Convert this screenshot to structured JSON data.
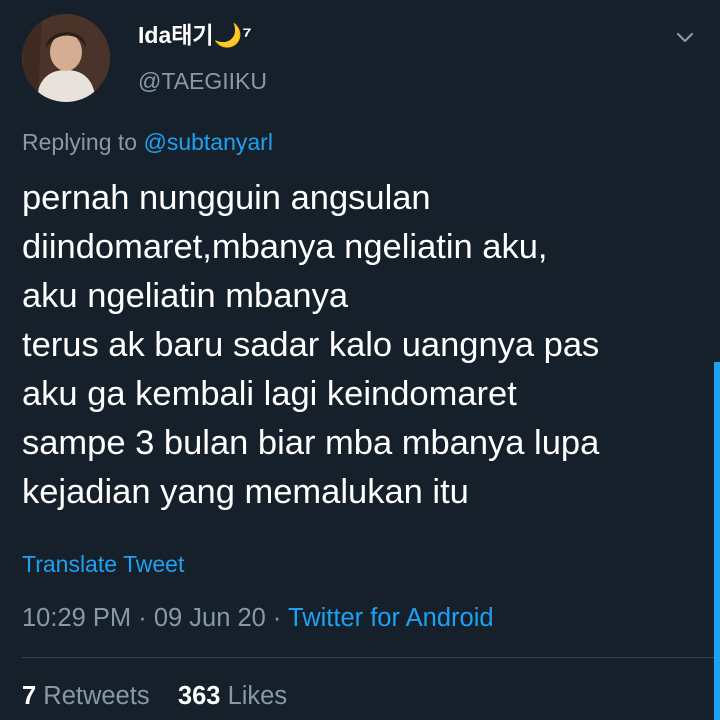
{
  "user": {
    "display_name": "Ida태기🌙⁷",
    "handle": "@TAEGIIKU"
  },
  "reply": {
    "prefix": "Replying to",
    "mention": "@subtanyarl"
  },
  "tweet": {
    "text": "pernah nungguin angsulan\ndiindomaret,mbanya ngeliatin aku,\naku ngeliatin mbanya\nterus ak baru sadar kalo uangnya pas\naku ga kembali lagi keindomaret\nsampe 3 bulan biar mba mbanya lupa\nkejadian yang memalukan itu",
    "translate_label": "Translate Tweet"
  },
  "meta": {
    "time": "10:29 PM",
    "date": "09 Jun 20",
    "separator": " · ",
    "source": "Twitter for Android"
  },
  "stats": {
    "retweets_count": "7",
    "retweets_label": "Retweets",
    "likes_count": "363",
    "likes_label": "Likes"
  },
  "icons": {
    "menu": "chevron-down-icon"
  },
  "colors": {
    "background": "#15202b",
    "accent": "#1da1f2",
    "secondary_text": "#8899a6"
  }
}
